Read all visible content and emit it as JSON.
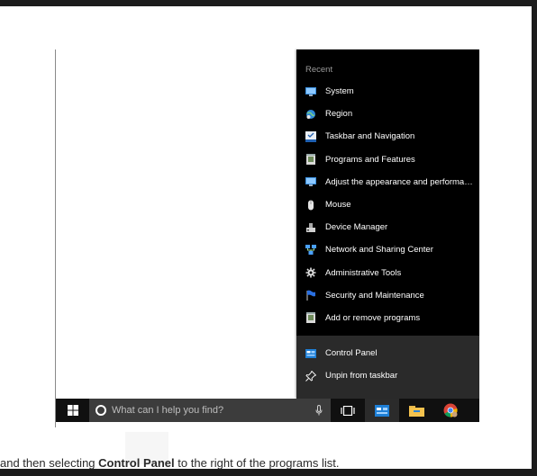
{
  "jumplist": {
    "header": "Recent",
    "recent_items": [
      {
        "label": "System",
        "icon": "system-monitor-icon"
      },
      {
        "label": "Region",
        "icon": "region-globe-icon"
      },
      {
        "label": "Taskbar and Navigation",
        "icon": "taskbar-navigation-icon"
      },
      {
        "label": "Programs and Features",
        "icon": "programs-features-icon"
      },
      {
        "label": "Adjust the appearance and performance of Windows",
        "icon": "system-monitor-icon"
      },
      {
        "label": "Mouse",
        "icon": "mouse-icon"
      },
      {
        "label": "Device Manager",
        "icon": "device-manager-icon"
      },
      {
        "label": "Network and Sharing Center",
        "icon": "network-icon"
      },
      {
        "label": "Administrative Tools",
        "icon": "admin-tools-gear-icon"
      },
      {
        "label": "Security and Maintenance",
        "icon": "security-flag-icon"
      },
      {
        "label": "Add or remove programs",
        "icon": "programs-features-icon"
      }
    ],
    "actions": [
      {
        "label": "Control Panel",
        "icon": "control-panel-icon"
      },
      {
        "label": "Unpin from taskbar",
        "icon": "unpin-icon"
      }
    ]
  },
  "taskbar": {
    "search_placeholder": "What can I help you find?",
    "buttons": [
      "start-icon",
      "task-view-icon",
      "control-panel-icon",
      "file-explorer-icon",
      "chrome-icon"
    ]
  },
  "caption": {
    "before": "and then selecting ",
    "strong": "Control Panel",
    "after": " to the right of the programs list."
  }
}
